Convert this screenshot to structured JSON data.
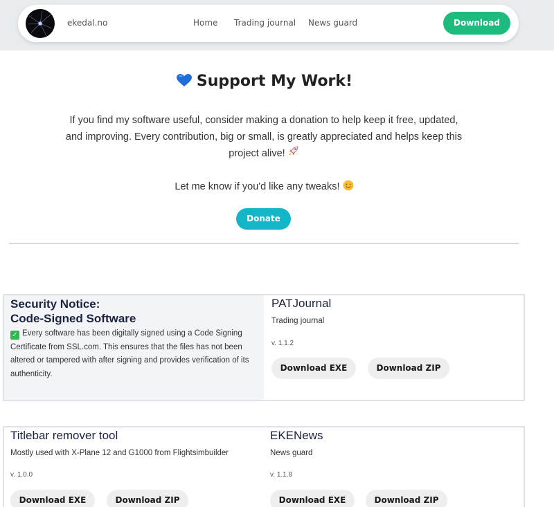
{
  "nav": {
    "brand": "ekedal.no",
    "links": [
      "Home",
      "Trading journal",
      "News guard"
    ],
    "download_label": "Download"
  },
  "support": {
    "title": "Support My Work!",
    "paragraph": "If you find my software useful, consider making a donation to help keep it free, updated, and improving. Every contribution, big or small, is greatly appreciated and helps keep this project alive!",
    "tweak_line": "Let me know if you'd like any tweaks!",
    "donate_label": "Donate"
  },
  "notice": {
    "title_line1": "Security Notice:",
    "title_line2": "Code-Signed Software",
    "body": "Every software has been digitally signed using a Code Signing Certificate from SSL.com. This ensures that the files has not been altered or tampered with after signing and provides verification of its authenticity."
  },
  "products": [
    {
      "name": "PATJournal",
      "subtitle": "Trading journal",
      "version": "v. 1.1.2",
      "exe_label": "Download EXE",
      "zip_label": "Download ZIP"
    },
    {
      "name": "Titlebar remover tool",
      "subtitle": "Mostly used with X-Plane 12 and G1000 from Flightsimbuilder",
      "version": "v. 1.0.0",
      "exe_label": "Download EXE",
      "zip_label": "Download ZIP"
    },
    {
      "name": "EKENews",
      "subtitle": "News guard",
      "version": "v. 1.1.8",
      "exe_label": "Download EXE",
      "zip_label": "Download ZIP"
    }
  ],
  "colors": {
    "download_green": "#1dbb7e",
    "donate_teal": "#15b5c8",
    "heading_navy": "#1c2340"
  },
  "icons": [
    "blue-heart-icon",
    "rocket-icon",
    "smile-icon",
    "checkmark-icon"
  ]
}
